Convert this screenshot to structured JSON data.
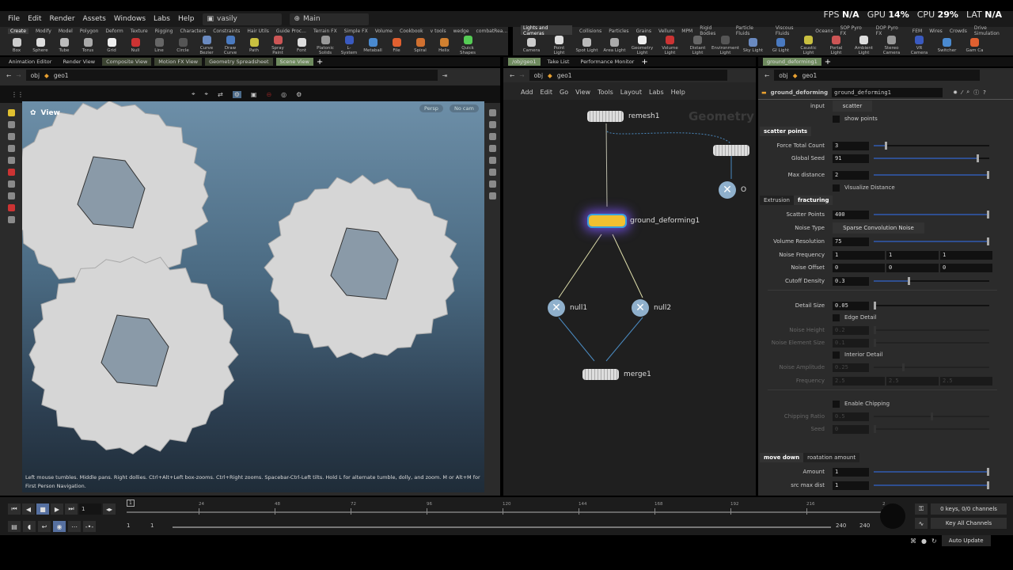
{
  "menu": [
    "File",
    "Edit",
    "Render",
    "Assets",
    "Windows",
    "Labs",
    "Help"
  ],
  "desktop": "vasily",
  "context": "Main",
  "stats": {
    "fps_label": "FPS",
    "fps": "N/A",
    "gpu_label": "GPU",
    "gpu": "14%",
    "cpu_label": "CPU",
    "cpu": "29%",
    "lat_label": "LAT",
    "lat": "N/A"
  },
  "shelf_left_tabs": [
    "Create",
    "Modify",
    "Model",
    "Polygon",
    "Deform",
    "Texture",
    "Rigging",
    "Characters",
    "Constraints",
    "Hair Utils",
    "Guide Proc...",
    "Terrain FX",
    "Simple FX",
    "Volume",
    "Cookbook",
    "v tools",
    "wedge",
    "combatRea..."
  ],
  "shelf_left_tools": [
    "Box",
    "Sphere",
    "Tube",
    "Torus",
    "Grid",
    "Null",
    "Line",
    "Circle",
    "Curve Bezier",
    "Draw Curve",
    "Path",
    "Spray Paint",
    "Font",
    "Platonic Solids",
    "L-System",
    "Metaball",
    "File",
    "Spiral",
    "Helix",
    "Quick Shapes"
  ],
  "shelf_right_tabs": [
    "Lights and Cameras",
    "Collisions",
    "Particles",
    "Grains",
    "Vellum",
    "MPM",
    "Rigid Bodies",
    "Particle Fluids",
    "Viscous Fluids",
    "Oceans",
    "SOP Pyro FX",
    "DOP Pyro FX",
    "FEM",
    "Wires",
    "Crowds",
    "Drive Simulation"
  ],
  "shelf_right_tools": [
    "Camera",
    "Point Light",
    "Spot Light",
    "Area Light",
    "Geometry Light",
    "Volume Light",
    "Distant Light",
    "Environment Light",
    "Sky Light",
    "GI Light",
    "Caustic Light",
    "Portal Light",
    "Ambient Light",
    "Stereo Camera",
    "VR Camera",
    "Switcher",
    "Gam Ca"
  ],
  "left_pane_tabs": [
    "Animation Editor",
    "Render View",
    "Composite View",
    "Motion FX View",
    "Geometry Spreadsheet",
    "Scene View"
  ],
  "mid_pane_tabs": [
    "/obj/geo1",
    "Take List",
    "Performance Monitor"
  ],
  "right_pane_tabs": [
    "ground_deforming1"
  ],
  "path": {
    "root": "obj",
    "node": "geo1"
  },
  "viewport": {
    "label": "View",
    "persp": "Persp",
    "cam": "No cam",
    "status": "Left mouse tumbles. Middle pans. Right dollies. Ctrl+Alt+Left box-zooms. Ctrl+Right zooms. Spacebar-Ctrl-Left tilts. Hold L for alternate tumble, dolly, and zoom. M or Alt+M for First Person Navigation."
  },
  "network": {
    "menu": [
      "Add",
      "Edit",
      "Go",
      "View",
      "Tools",
      "Layout",
      "Labs",
      "Help"
    ],
    "watermark": "Geometry",
    "nodes": {
      "remesh": "remesh1",
      "ground": "ground_deforming1",
      "null1": "null1",
      "null2": "null2",
      "merge": "merge1",
      "offscreen": "O"
    }
  },
  "params": {
    "node_type": "ground_deforming",
    "node_name": "ground_deforming1",
    "input_label": "input",
    "input_value": "scatter",
    "show_points": "show points",
    "tab_scatter": "scatter points",
    "force_total_count": {
      "label": "Force Total Count",
      "value": "3",
      "fraction": 0.1
    },
    "global_seed": {
      "label": "Global Seed",
      "value": "91",
      "fraction": 0.91
    },
    "max_distance": {
      "label": "Max distance",
      "value": "2",
      "fraction": 1
    },
    "visualize_distance": "Visualize Distance",
    "tabs2": [
      "Extrusion",
      "fracturing"
    ],
    "scatter_points": {
      "label": "Scatter Points",
      "value": "400",
      "fraction": 1
    },
    "noise_type": {
      "label": "Noise Type",
      "value": "Sparse Convolution Noise"
    },
    "volume_resolution": {
      "label": "Volume Resolution",
      "value": "75",
      "fraction": 1
    },
    "noise_frequency": {
      "label": "Noise Frequency",
      "values": [
        "1",
        "1",
        "1"
      ]
    },
    "noise_offset": {
      "label": "Noise Offset",
      "values": [
        "0",
        "0",
        "0"
      ]
    },
    "cutoff_density": {
      "label": "Cutoff Density",
      "value": "0.3",
      "fraction": 0.3
    },
    "detail_size": {
      "label": "Detail Size",
      "value": "0.05",
      "fraction": 0
    },
    "edge_detail": "Edge Detail",
    "noise_height": {
      "label": "Noise Height",
      "value": "0.2"
    },
    "noise_element_size": {
      "label": "Noise Element Size",
      "value": "0.1"
    },
    "interior_detail": "Interior Detail",
    "noise_amplitude": {
      "label": "Noise Amplitude",
      "value": "0.25"
    },
    "frequency": {
      "label": "Frequency",
      "values": [
        "2.5",
        "2.5",
        "2.5"
      ]
    },
    "enable_chipping": "Enable Chipping",
    "chipping_ratio": {
      "label": "Chipping Ratio",
      "value": "0.5"
    },
    "seed": {
      "label": "Seed",
      "value": "0"
    },
    "tabs3": [
      "move down",
      "roatation amount"
    ],
    "amount": {
      "label": "Amount",
      "value": "1",
      "fraction": 1
    },
    "src_max_dist": {
      "label": "src max dist",
      "value": "1",
      "fraction": 1
    }
  },
  "timeline": {
    "frame": "1",
    "ticks": [
      "24",
      "48",
      "72",
      "96",
      "120",
      "144",
      "168",
      "192",
      "216",
      "2"
    ],
    "marker": "1",
    "start": "1",
    "start2": "1",
    "end": "240",
    "end2": "240",
    "keys": "0 keys, 0/0 channels",
    "key_all": "Key All Channels",
    "auto_update": "Auto Update"
  }
}
